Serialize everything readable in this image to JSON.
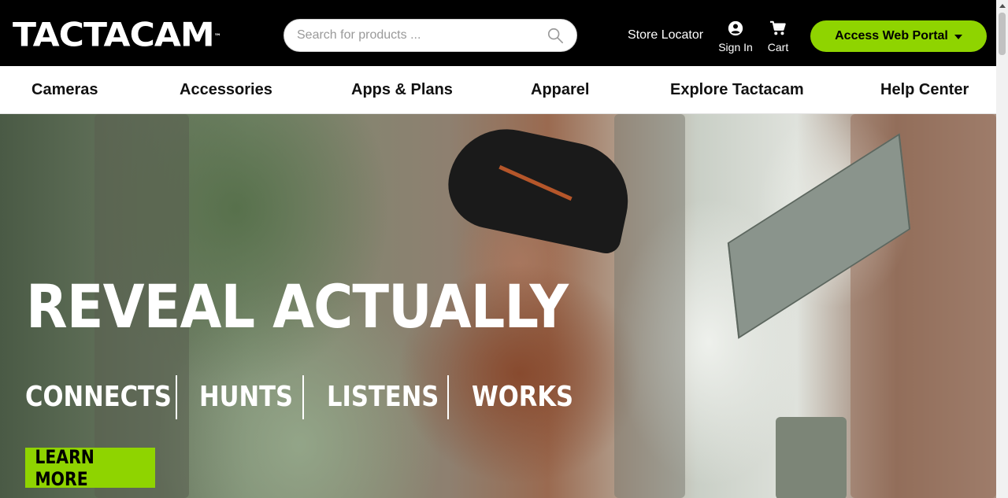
{
  "brand": {
    "logo_text": "TACTACAM",
    "trademark": "™"
  },
  "search": {
    "placeholder": "Search for products ...",
    "value": ""
  },
  "header": {
    "store_locator": "Store Locator",
    "sign_in": "Sign In",
    "cart": "Cart",
    "portal_button": "Access Web Portal",
    "icons": {
      "search": "search-icon",
      "account": "account-circle-icon",
      "cart": "cart-icon",
      "portal": "caret-down-icon"
    }
  },
  "nav": {
    "items": [
      {
        "label": "Cameras"
      },
      {
        "label": "Accessories"
      },
      {
        "label": "Apps & Plans"
      },
      {
        "label": "Apparel"
      },
      {
        "label": "Explore Tactacam"
      },
      {
        "label": "Help Center"
      }
    ]
  },
  "hero": {
    "title": "REVEAL ACTUALLY",
    "features": [
      "CONNECTS",
      "HUNTS",
      "LISTENS",
      "WORKS"
    ],
    "cta": "LEARN MORE"
  },
  "colors": {
    "header_bg": "#000000",
    "accent_green": "#8fd400",
    "nav_bg": "#ffffff"
  }
}
